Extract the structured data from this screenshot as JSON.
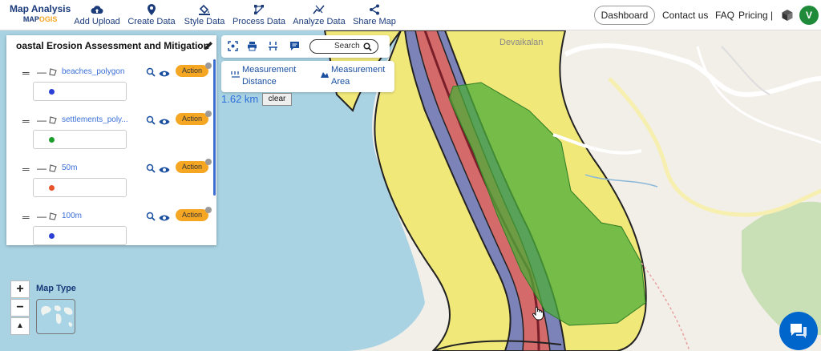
{
  "app": {
    "logo_line1": "Map Analysis",
    "logo_line2_a": "MAP",
    "logo_line2_b": "OGIS"
  },
  "nav": [
    {
      "label": "Add Upload",
      "icon": "cloud-upload-icon"
    },
    {
      "label": "Create Data",
      "icon": "pin-icon"
    },
    {
      "label": "Style Data",
      "icon": "paint-bucket-icon"
    },
    {
      "label": "Process Data",
      "icon": "process-icon"
    },
    {
      "label": "Analyze Data",
      "icon": "analyze-icon"
    },
    {
      "label": "Share Map",
      "icon": "share-icon"
    }
  ],
  "header_right": {
    "dashboard": "Dashboard",
    "contact": "Contact us",
    "faq": "FAQ",
    "pricing": "Pricing |",
    "avatar_letter": "V"
  },
  "panel": {
    "title": "oastal Erosion Assessment and Mitigation",
    "layers": [
      {
        "name": "beaches_polygon",
        "action": "Action",
        "color": "#2b3fd6"
      },
      {
        "name": "settlements_poly...",
        "action": "Action",
        "color": "#1b9e2b"
      },
      {
        "name": "50m",
        "action": "Action",
        "color": "#e8542a"
      },
      {
        "name": "100m",
        "action": "Action",
        "color": "#2b3fd6"
      }
    ]
  },
  "measure": {
    "search_label": "Search",
    "distance_line1": "Measurement",
    "distance_line2": "Distance",
    "area_line1": "Measurement",
    "area_line2": "Area",
    "result": "1.62 km",
    "clear_label": "clear"
  },
  "map": {
    "place_label": "Devaikalan",
    "map_type_label": "Map Type",
    "zoom_in": "+",
    "zoom_out": "−",
    "compass": "▲",
    "colors": {
      "water": "#a9d3e3",
      "beach_yellow": "#f1e87a",
      "buffer_red": "#d46a6a",
      "buffer_purple": "#7c83b8",
      "settlement_green": "#4cad3a",
      "land": "#f2efe9"
    }
  }
}
